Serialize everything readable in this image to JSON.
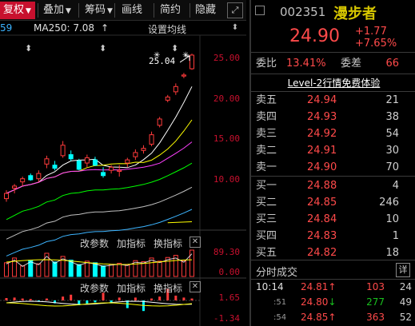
{
  "toolbar": {
    "items": [
      {
        "label": "复权",
        "arrow": "▼"
      },
      {
        "label": "叠加",
        "arrow": "▼"
      },
      {
        "label": "筹码",
        "arrow": "▼"
      },
      {
        "label": "画线"
      },
      {
        "label": "简约"
      },
      {
        "label": "隐藏"
      }
    ],
    "fullscreen_icon": "⤢"
  },
  "chart": {
    "ma_prefix": "59",
    "ma250_text": "MA250: 7.08",
    "ma_arrow": "↑",
    "settings_label": "设置均线",
    "high_label": "25.04",
    "y_labels": [
      "25.00",
      "20.00",
      "15.00",
      "10.00"
    ],
    "sub1": {
      "btn1": "改参数",
      "btn2": "加指标",
      "btn3": "换指标",
      "close": "✕",
      "top_label": "89.30",
      "bottom_label": "0.00"
    },
    "sub2": {
      "btn1": "改参数",
      "btn2": "加指标",
      "btn3": "换指标",
      "close": "✕",
      "top_label": "1.65",
      "bottom_label": "-1.34"
    },
    "colors": {
      "up": "#ff3b3b",
      "down": "#00ffff",
      "ma5": "#ffffff",
      "ma10": "#ffff00",
      "ma20": "#ff40ff",
      "ma60": "#00ff00",
      "ma120": "#3cb4ff",
      "ma250": "#ffff00"
    }
  },
  "chart_data": {
    "type": "candlestick",
    "ylim": [
      8.5,
      26.5
    ],
    "candles": [
      {
        "o": 11.2,
        "h": 12.0,
        "l": 10.9,
        "c": 11.7
      },
      {
        "o": 12.2,
        "h": 12.6,
        "l": 11.7,
        "c": 12.4
      },
      {
        "o": 12.8,
        "h": 13.3,
        "l": 12.4,
        "c": 13.1
      },
      {
        "o": 13.4,
        "h": 13.6,
        "l": 12.9,
        "c": 13.0
      },
      {
        "o": 13.1,
        "h": 13.9,
        "l": 12.8,
        "c": 13.6
      },
      {
        "o": 14.5,
        "h": 15.3,
        "l": 14.1,
        "c": 15.0
      },
      {
        "o": 14.4,
        "h": 14.8,
        "l": 13.9,
        "c": 14.1
      },
      {
        "o": 15.3,
        "h": 16.7,
        "l": 15.1,
        "c": 16.3
      },
      {
        "o": 15.4,
        "h": 15.8,
        "l": 14.8,
        "c": 15.0
      },
      {
        "o": 14.8,
        "h": 15.0,
        "l": 13.9,
        "c": 14.0
      },
      {
        "o": 14.6,
        "h": 15.4,
        "l": 14.2,
        "c": 15.1
      },
      {
        "o": 14.9,
        "h": 15.2,
        "l": 14.3,
        "c": 14.4
      },
      {
        "o": 13.7,
        "h": 14.2,
        "l": 13.2,
        "c": 13.4
      },
      {
        "o": 13.9,
        "h": 14.4,
        "l": 13.6,
        "c": 14.2
      },
      {
        "o": 13.8,
        "h": 14.4,
        "l": 13.3,
        "c": 13.9
      },
      {
        "o": 14.6,
        "h": 15.1,
        "l": 14.2,
        "c": 14.9
      },
      {
        "o": 15.2,
        "h": 15.9,
        "l": 14.9,
        "c": 15.6
      },
      {
        "o": 15.8,
        "h": 16.3,
        "l": 15.5,
        "c": 16.0
      },
      {
        "o": 16.4,
        "h": 17.6,
        "l": 16.2,
        "c": 17.3
      },
      {
        "o": 18.2,
        "h": 19.0,
        "l": 18.0,
        "c": 18.8
      },
      {
        "o": 20.6,
        "h": 21.1,
        "l": 20.4,
        "c": 20.9
      },
      {
        "o": 21.4,
        "h": 22.2,
        "l": 21.1,
        "c": 21.9
      },
      {
        "o": 22.9,
        "h": 23.2,
        "l": 22.7,
        "c": 23.0
      },
      {
        "o": 23.6,
        "h": 25.04,
        "l": 23.5,
        "c": 24.9
      }
    ],
    "volumes": [
      52,
      70,
      40,
      62,
      48,
      88,
      55,
      76,
      62,
      45,
      58,
      52,
      40,
      46,
      50,
      44,
      60,
      56,
      70,
      58,
      72,
      80,
      60,
      100
    ],
    "macd": [
      0.25,
      0.3,
      0.2,
      0.15,
      -0.1,
      0.2,
      -0.3,
      0.4,
      0.6,
      -0.5,
      -0.4,
      -0.2,
      0.8,
      -0.3,
      0.3,
      -0.8,
      0.3,
      -1.1,
      0.2,
      0.4,
      1.2,
      0.5,
      0.3,
      0.2
    ]
  },
  "quote": {
    "code": "002351",
    "name": "漫步者",
    "price": "24.90",
    "change": "+1.77",
    "change_pct": "+7.65%",
    "weibi_label": "委比",
    "weibi_value": "13.41%",
    "weicha_label": "委差",
    "weicha_value": "66",
    "level2_text": "Level-2行情免费体验",
    "asks": [
      {
        "name": "卖五",
        "price": "24.94",
        "vol": "21"
      },
      {
        "name": "卖四",
        "price": "24.93",
        "vol": "38"
      },
      {
        "name": "卖三",
        "price": "24.92",
        "vol": "54"
      },
      {
        "name": "卖二",
        "price": "24.91",
        "vol": "30"
      },
      {
        "name": "卖一",
        "price": "24.90",
        "vol": "70"
      }
    ],
    "bids": [
      {
        "name": "买一",
        "price": "24.88",
        "vol": "4"
      },
      {
        "name": "买二",
        "price": "24.85",
        "vol": "246"
      },
      {
        "name": "买三",
        "price": "24.84",
        "vol": "10"
      },
      {
        "name": "买四",
        "price": "24.83",
        "vol": "1"
      },
      {
        "name": "买五",
        "price": "24.82",
        "vol": "18"
      }
    ],
    "ticks_header": "分时成交",
    "detail_label": "详",
    "ticks": [
      {
        "time": "10:14",
        "price": "24.81",
        "dir": "↑",
        "vol": "103",
        "cnt": "24",
        "dimtime": false
      },
      {
        "time": ":51",
        "price": "24.80",
        "dir": "↓",
        "vol": "277",
        "cnt": "49",
        "dimtime": true
      },
      {
        "time": ":54",
        "price": "24.85",
        "dir": "↑",
        "vol": "363",
        "cnt": "52",
        "dimtime": true
      }
    ]
  }
}
